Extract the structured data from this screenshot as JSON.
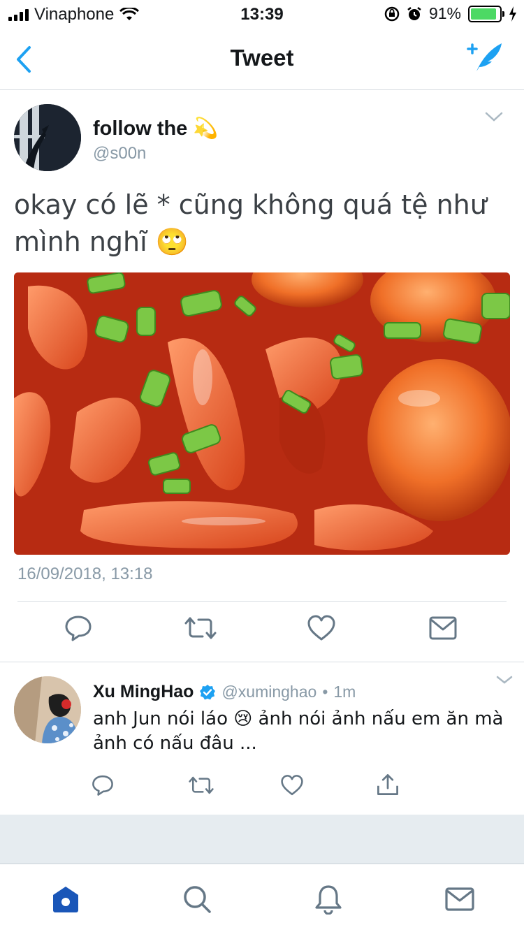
{
  "status_bar": {
    "carrier": "Vinaphone",
    "time": "13:39",
    "battery_percent": "91%",
    "battery_level": 0.91,
    "battery_color": "#4cd964"
  },
  "nav": {
    "title": "Tweet",
    "back_icon": "chevron-left-icon",
    "compose_icon": "compose-tweet-icon",
    "accent_color": "#1da1f2"
  },
  "main_tweet": {
    "display_name": "follow the",
    "name_emoji": "💫",
    "handle": "@s00n",
    "text": "okay có lẽ * cũng không quá tệ như mình nghĩ 🙄",
    "timestamp": "16/09/2018, 13:18",
    "actions": [
      "reply-icon",
      "retweet-icon",
      "like-icon",
      "message-icon"
    ]
  },
  "reply_tweet": {
    "display_name": "Xu MingHao",
    "verified": true,
    "handle": "@xuminghao",
    "separator": "•",
    "time": "1m",
    "text": "anh Jun nói láo 😢 ảnh nói ảnh nấu em ăn mà ảnh có nấu đâu ...",
    "actions": [
      "reply-icon",
      "retweet-icon",
      "like-icon",
      "share-icon"
    ]
  },
  "tab_bar": {
    "tabs": [
      "home-icon",
      "search-icon",
      "notifications-icon",
      "messages-icon"
    ],
    "active": "home-icon"
  }
}
